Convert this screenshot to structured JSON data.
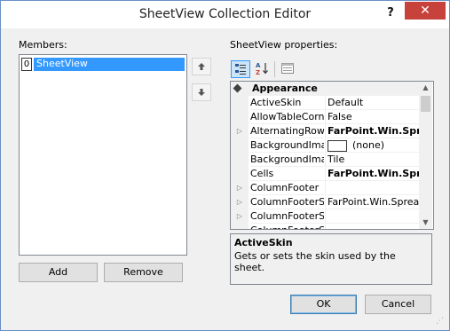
{
  "window": {
    "title": "SheetView Collection Editor",
    "help": "?",
    "close": "✕"
  },
  "members": {
    "label": "Members:",
    "items": [
      {
        "index": "0",
        "name": "SheetView"
      }
    ],
    "up_icon": "arrow-up-icon",
    "down_icon": "arrow-down-icon",
    "add_label": "Add",
    "remove_label": "Remove"
  },
  "properties": {
    "label": "SheetView properties:",
    "category": "Appearance",
    "rows": [
      {
        "expandable": false,
        "name": "ActiveSkin",
        "value": "Default",
        "bold": false,
        "swatch": false
      },
      {
        "expandable": false,
        "name": "AllowTableCorne",
        "value": "False",
        "bold": false,
        "swatch": false
      },
      {
        "expandable": true,
        "name": "AlternatingRows",
        "value": "FarPoint.Win.Spre",
        "bold": true,
        "swatch": false
      },
      {
        "expandable": false,
        "name": "BackgroundImag",
        "value": "(none)",
        "bold": false,
        "swatch": true
      },
      {
        "expandable": false,
        "name": "BackgroundImag",
        "value": "Tile",
        "bold": false,
        "swatch": false
      },
      {
        "expandable": false,
        "name": "Cells",
        "value": "FarPoint.Win.Spre",
        "bold": true,
        "swatch": false
      },
      {
        "expandable": true,
        "name": "ColumnFooter",
        "value": "",
        "bold": false,
        "swatch": false
      },
      {
        "expandable": true,
        "name": "ColumnFooterSh",
        "value": "FarPoint.Win.Spread.",
        "bold": false,
        "swatch": false
      },
      {
        "expandable": true,
        "name": "ColumnFooterSh",
        "value": "",
        "bold": false,
        "swatch": false
      },
      {
        "expandable": false,
        "name": "ColumnFooterSh",
        "value": "",
        "bold": false,
        "swatch": false
      }
    ],
    "description_title": "ActiveSkin",
    "description_text": "Gets or sets the skin used by the sheet."
  },
  "footer": {
    "ok_label": "OK",
    "cancel_label": "Cancel"
  },
  "colors": {
    "selection": "#3399ff",
    "close_button": "#c7423a",
    "window_border": "#6a8fc7"
  }
}
